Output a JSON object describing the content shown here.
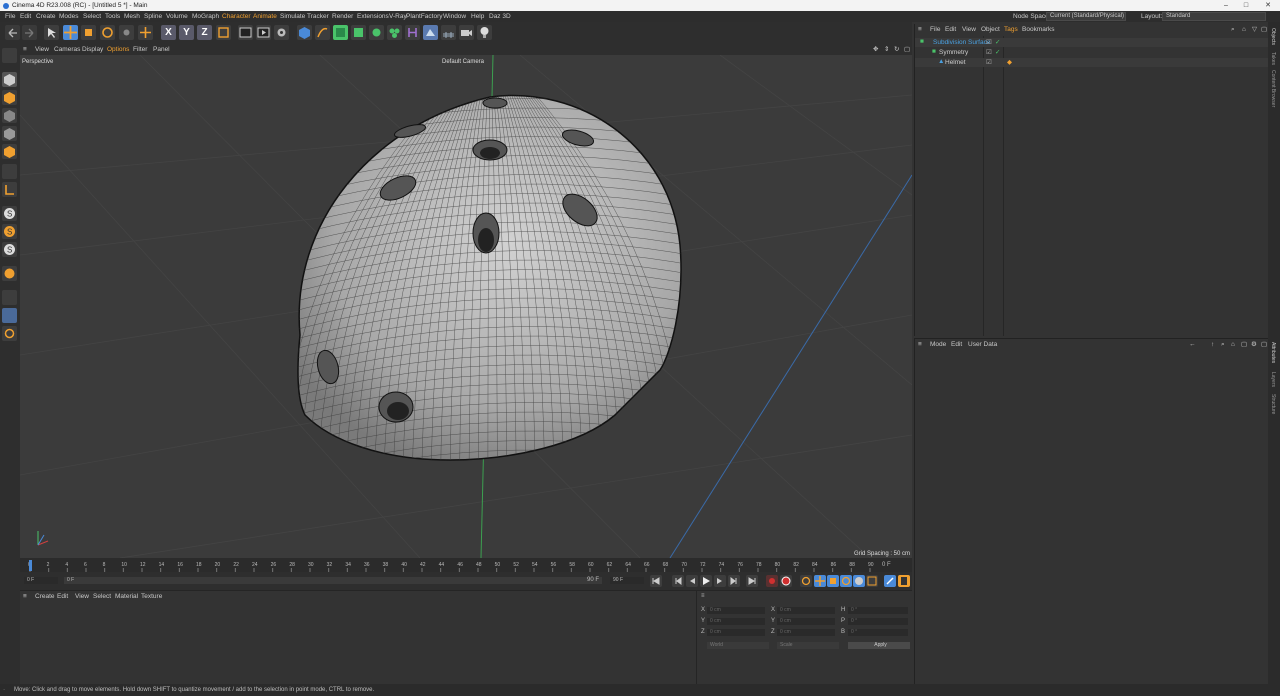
{
  "window": {
    "title": "Cinema 4D R23.008 (RC) - [Untitled 5 *] - Main"
  },
  "menu": [
    "File",
    "Edit",
    "Create",
    "Modes",
    "Select",
    "Tools",
    "Mesh",
    "Spline",
    "Volume",
    "MoGraph",
    "Character",
    "Animate",
    "Simulate",
    "Tracker",
    "Render",
    "Extensions",
    "V-Ray",
    "PlantFactory",
    "Window",
    "Help",
    "Daz 3D"
  ],
  "nodespace": {
    "label": "Node Space:",
    "value": "Current (Standard/Physical)"
  },
  "layout": {
    "label": "Layout:",
    "value": "Standard"
  },
  "viewport_menu": [
    "View",
    "Cameras",
    "Display",
    "Options",
    "Filter",
    "Panel"
  ],
  "viewport": {
    "name": "Perspective",
    "camera": "Default Camera",
    "grid_spacing": "Grid Spacing : 50 cm"
  },
  "timeline": {
    "ticks": [
      "0",
      "2",
      "4",
      "6",
      "8",
      "10",
      "12",
      "14",
      "16",
      "18",
      "20",
      "22",
      "24",
      "26",
      "28",
      "30",
      "32",
      "34",
      "36",
      "38",
      "40",
      "42",
      "44",
      "46",
      "48",
      "50",
      "52",
      "54",
      "56",
      "58",
      "60",
      "62",
      "64",
      "66",
      "68",
      "70",
      "72",
      "74",
      "76",
      "78",
      "80",
      "82",
      "84",
      "86",
      "88",
      "90"
    ],
    "end_frame": "0 F",
    "current": "0 F",
    "start": "0 F",
    "max": "90 F",
    "max2": "90 F"
  },
  "material_menu": [
    "Create",
    "Edit",
    "View",
    "Select",
    "Material",
    "Texture"
  ],
  "coords": {
    "rows": [
      {
        "a": "X",
        "av": "0 cm",
        "b": "X",
        "bv": "0 cm",
        "c": "H",
        "cv": "0 °"
      },
      {
        "a": "Y",
        "av": "0 cm",
        "b": "Y",
        "bv": "0 cm",
        "c": "P",
        "cv": "0 °"
      },
      {
        "a": "Z",
        "av": "0 cm",
        "b": "Z",
        "bv": "0 cm",
        "c": "B",
        "cv": "0 °"
      }
    ],
    "mode1": "World",
    "mode2": "Scale",
    "apply": "Apply"
  },
  "object_manager": {
    "menu": [
      "File",
      "Edit",
      "View",
      "Object",
      "Tags",
      "Bookmarks"
    ],
    "objects": [
      {
        "name": "Subdivision Surface",
        "indent": 0
      },
      {
        "name": "Symmetry",
        "indent": 1
      },
      {
        "name": "Helmet",
        "indent": 2
      }
    ]
  },
  "attribute_manager": {
    "menu": [
      "Mode",
      "Edit",
      "User Data"
    ]
  },
  "right_tabs": [
    "Objects",
    "Takes",
    "Content Browser",
    "Attributes",
    "Layers",
    "Structure"
  ],
  "status": "Move: Click and drag to move elements. Hold down SHIFT to quantize movement / add to the selection in point mode, CTRL to remove.",
  "colors": {
    "accent": "#f0a030",
    "select": "#4a8ad8",
    "green": "#4ac36a"
  }
}
